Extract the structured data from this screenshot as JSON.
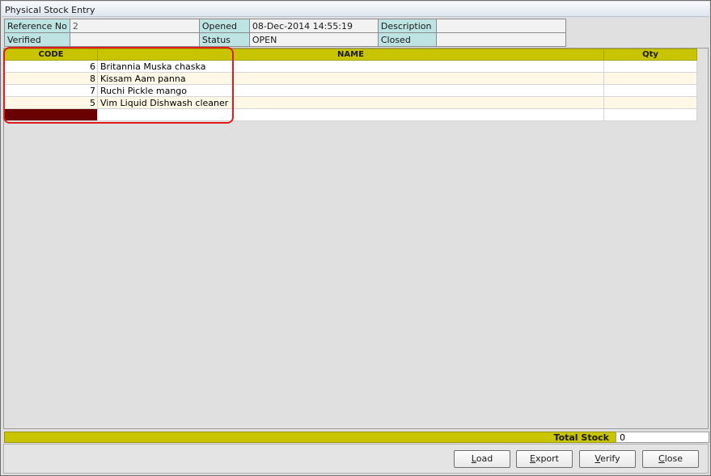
{
  "window": {
    "title": "Physical Stock Entry"
  },
  "header": {
    "reference_no_label": "Reference No",
    "reference_no_value": "2",
    "opened_label": "Opened",
    "opened_value": "08-Dec-2014 14:55:19",
    "description_label": "Description",
    "description_value": "",
    "verified_label": "Verified",
    "verified_value": "",
    "status_label": "Status",
    "status_value": "OPEN",
    "closed_label": "Closed",
    "closed_value": ""
  },
  "grid": {
    "columns": [
      "CODE",
      "NAME",
      "Qty"
    ],
    "rows": [
      {
        "code": "6",
        "name": "Britannia Muska chaska",
        "qty": ""
      },
      {
        "code": "8",
        "name": "Kissam Aam panna",
        "qty": ""
      },
      {
        "code": "7",
        "name": "Ruchi Pickle mango",
        "qty": ""
      },
      {
        "code": "5",
        "name": "Vim Liquid Dishwash cleaner",
        "qty": ""
      },
      {
        "code": "",
        "name": "",
        "qty": ""
      }
    ]
  },
  "totals": {
    "label": "Total Stock",
    "value": "0"
  },
  "buttons": {
    "load": {
      "mnemonic": "L",
      "rest": "oad"
    },
    "export": {
      "mnemonic": "E",
      "rest": "xport"
    },
    "verify": {
      "mnemonic": "V",
      "rest": "erify"
    },
    "close": {
      "mnemonic": "C",
      "rest": "lose"
    }
  },
  "colors": {
    "header_label_bg": "#bde3e3",
    "grid_header_bg": "#c8c400",
    "active_cell_bg": "#6b0000",
    "highlight_border": "#e01b1b"
  }
}
